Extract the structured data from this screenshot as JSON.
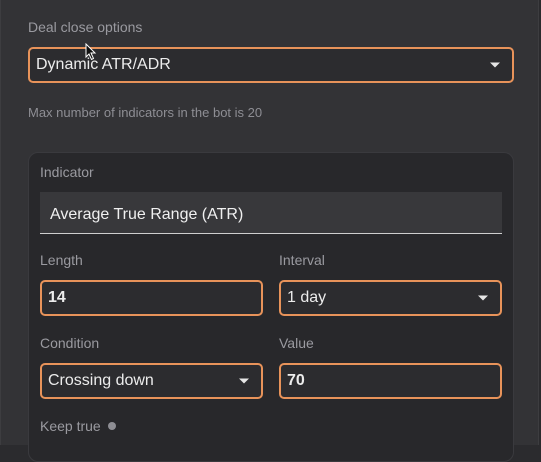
{
  "deal_close": {
    "label": "Deal close options",
    "selected": "Dynamic ATR/ADR",
    "hint": "Max number of indicators in the bot is 20"
  },
  "indicator_card": {
    "indicator_label": "Indicator",
    "indicator_value": "Average True Range (ATR)",
    "length_label": "Length",
    "length_value": "14",
    "interval_label": "Interval",
    "interval_value": "1 day",
    "condition_label": "Condition",
    "condition_value": "Crossing down",
    "value_label": "Value",
    "value_value": "70",
    "keep_true_label": "Keep true"
  },
  "colors": {
    "accent": "#e8935a",
    "background": "#333336",
    "card": "#28282b"
  },
  "icons": [
    "chevron-down-icon",
    "info-icon",
    "mouse-cursor-icon"
  ]
}
